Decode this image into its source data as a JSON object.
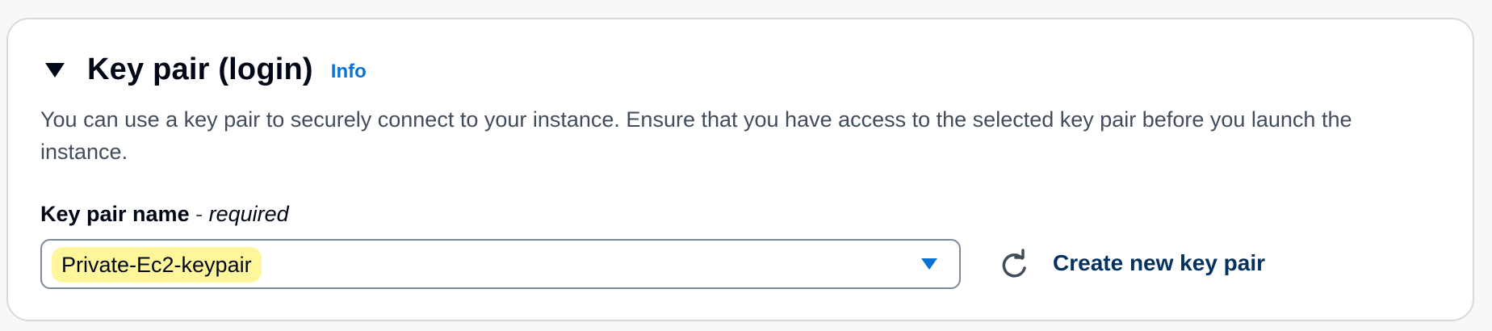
{
  "section": {
    "title": "Key pair (login)",
    "info_label": "Info",
    "description": "You can use a key pair to securely connect to your instance. Ensure that you have access to the selected key pair before you launch the instance."
  },
  "field": {
    "label": "Key pair name",
    "separator": " - ",
    "required_label": "required",
    "selected_value": "Private-Ec2-keypair"
  },
  "actions": {
    "create_label": "Create new key pair"
  },
  "icons": {
    "toggle": "caret-down-filled-icon",
    "dropdown": "caret-down-icon",
    "refresh": "refresh-icon"
  },
  "colors": {
    "link": "#0972d3",
    "create_link": "#033160",
    "highlight": "#fff59a",
    "border": "#d5dbdb"
  }
}
